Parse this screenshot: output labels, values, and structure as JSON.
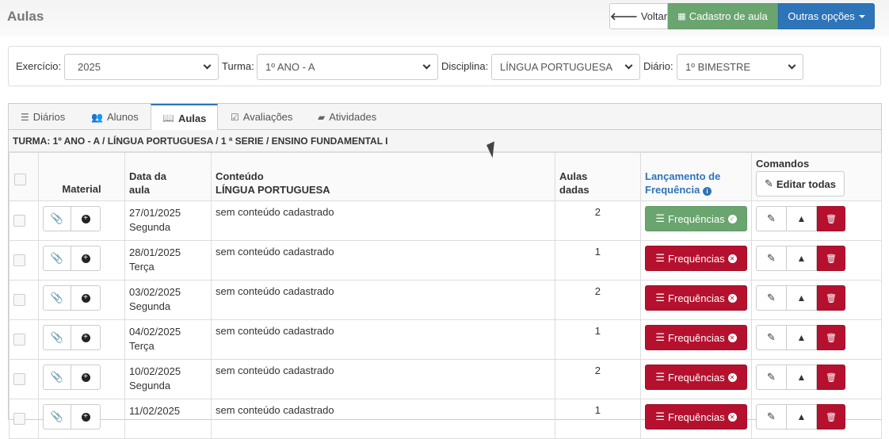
{
  "page": {
    "title": "Aulas",
    "buttons": {
      "voltar": "Voltar",
      "cadastro": "Cadastro de aula",
      "outras": "Outras opções"
    }
  },
  "filters": {
    "exercicio_label": "Exercício:",
    "exercicio_value": "2025",
    "turma_label": "Turma:",
    "turma_value": "1º ANO - A",
    "disciplina_label": "Disciplina:",
    "disciplina_value": "LÍNGUA PORTUGUESA",
    "diario_label": "Diário:",
    "diario_value": "1º BIMESTRE"
  },
  "tabs": [
    {
      "label": "Diários",
      "icon": "list-icon"
    },
    {
      "label": "Alunos",
      "icon": "users-icon"
    },
    {
      "label": "Aulas",
      "icon": "book-open-icon",
      "active": true
    },
    {
      "label": "Avaliações",
      "icon": "checkbox-edit-icon"
    },
    {
      "label": "Atividades",
      "icon": "book-icon"
    }
  ],
  "turma_info": "TURMA: 1º ANO - A / LÍNGUA PORTUGUESA / 1 ª SERIE / ENSINO FUNDAMENTAL I",
  "table": {
    "headers": {
      "material": "Material",
      "data_l1": "Data da",
      "data_l2": "aula",
      "conteudo_l1": "Conteúdo",
      "conteudo_l2": "LÍNGUA PORTUGUESA",
      "aulas_l1": "Aulas",
      "aulas_l2": "dadas",
      "lancamento_l1": "Lançamento de",
      "lancamento_l2": "Frequência",
      "comandos": "Comandos",
      "editar_todas": "Editar todas"
    },
    "freq_label": "Frequências",
    "rows": [
      {
        "date": "27/01/2025",
        "weekday": "Segunda",
        "content": "sem conteúdo cadastrado",
        "aulas": "2",
        "freq_status": "ok"
      },
      {
        "date": "28/01/2025",
        "weekday": "Terça",
        "content": "sem conteúdo cadastrado",
        "aulas": "1",
        "freq_status": "pending"
      },
      {
        "date": "03/02/2025",
        "weekday": "Segunda",
        "content": "sem conteúdo cadastrado",
        "aulas": "2",
        "freq_status": "pending"
      },
      {
        "date": "04/02/2025",
        "weekday": "Terça",
        "content": "sem conteúdo cadastrado",
        "aulas": "1",
        "freq_status": "pending"
      },
      {
        "date": "10/02/2025",
        "weekday": "Segunda",
        "content": "sem conteúdo cadastrado",
        "aulas": "2",
        "freq_status": "pending"
      },
      {
        "date": "11/02/2025",
        "weekday": "",
        "content": "sem conteúdo cadastrado",
        "aulas": "1",
        "freq_status": "pending"
      }
    ]
  },
  "colors": {
    "green": "#6aa56f",
    "blue": "#2e74b8",
    "red": "#b5112e"
  }
}
